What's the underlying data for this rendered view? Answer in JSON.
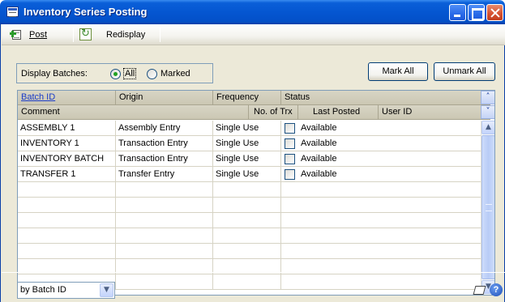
{
  "window": {
    "title": "Inventory Series Posting"
  },
  "toolbar": {
    "post_label": "Post",
    "redisplay_label": "Redisplay"
  },
  "filter": {
    "label": "Display Batches:",
    "options": [
      "All",
      "Marked"
    ],
    "selected": "All"
  },
  "buttons": {
    "mark_all": "Mark All",
    "unmark_all": "Unmark All"
  },
  "grid": {
    "header_row1": [
      "Batch ID",
      "Origin",
      "Frequency",
      "Status"
    ],
    "header_row2": [
      "Comment",
      "No. of Trx",
      "Last Posted",
      "User ID"
    ],
    "rows": [
      {
        "batch_id": "ASSEMBLY 1",
        "origin": "Assembly Entry",
        "frequency": "Single Use",
        "status": "Available",
        "marked": false
      },
      {
        "batch_id": "INVENTORY 1",
        "origin": "Transaction Entry",
        "frequency": "Single Use",
        "status": "Available",
        "marked": false
      },
      {
        "batch_id": "INVENTORY BATCH",
        "origin": "Transaction Entry",
        "frequency": "Single Use",
        "status": "Available",
        "marked": false
      },
      {
        "batch_id": "TRANSFER 1",
        "origin": "Transfer Entry",
        "frequency": "Single Use",
        "status": "Available",
        "marked": false
      }
    ]
  },
  "sort": {
    "selected": "by Batch ID"
  },
  "icons": {
    "app": "window-icon",
    "post": "post-icon",
    "redisplay": "redisplay-icon",
    "note": "note-icon",
    "help": "help-icon"
  },
  "colors": {
    "titlebar": "#0556d1",
    "window_bg": "#ece9d8",
    "header_bg": "#cbc7b3",
    "link": "#1a3cc8",
    "radio_dot": "#21a121"
  }
}
